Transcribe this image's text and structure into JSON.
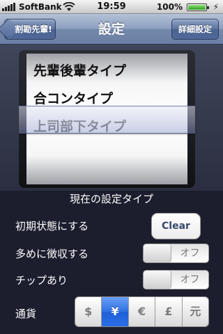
{
  "status_bar": {
    "carrier": "SoftBank",
    "time": "19:59",
    "battery": "100%",
    "icons": [
      "signal-icon",
      "wifi-icon",
      "battery-icon",
      "charging-plug-icon"
    ]
  },
  "nav": {
    "title": "設定",
    "back_label": "割勘先輩!",
    "detail_label": "詳細設定"
  },
  "picker": {
    "rows": [
      "先輩後輩タイプ",
      "合コンタイプ",
      "上司部下タイプ",
      ""
    ],
    "selected_index": 2
  },
  "settings": {
    "current_type_label": "現在の設定タイプ",
    "initial_state_label": "初期状態にする",
    "clear_label": "Clear",
    "collect_more_label": "多めに徴収する",
    "collect_more_state": "オフ",
    "tip_label": "チップあり",
    "tip_state": "オフ",
    "currency_label": "通貨",
    "currency_options": [
      "$",
      "¥",
      "€",
      "£",
      "元"
    ],
    "currency_selected_index": 1
  },
  "colors": {
    "nav_bar": "#7488ab",
    "panel_background": "#1c1e2e",
    "segment_selected": "#2f71e3",
    "clear_text": "#35496e"
  }
}
